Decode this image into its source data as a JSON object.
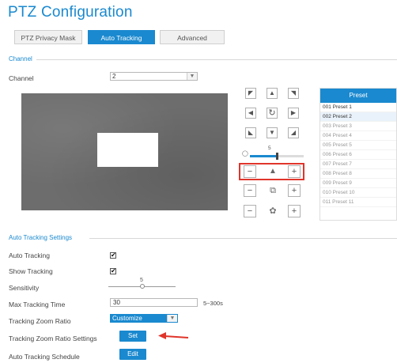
{
  "page": {
    "title": "PTZ Configuration"
  },
  "tabs": [
    {
      "label": "PTZ Privacy Mask"
    },
    {
      "label": "Auto Tracking"
    },
    {
      "label": "Advanced"
    }
  ],
  "channel_section": {
    "heading": "Channel",
    "channel_label": "Channel",
    "channel_value": "2"
  },
  "ptz": {
    "speed_value": "5",
    "speed_level": 0.5
  },
  "presets": {
    "header": "Preset",
    "items": [
      "001 Preset 1",
      "002 Preset 2",
      "003 Preset 3",
      "004 Preset 4",
      "005 Preset 5",
      "006 Preset 6",
      "007 Preset 7",
      "008 Preset 8",
      "009 Preset 9",
      "010 Preset 10",
      "011 Preset 11"
    ],
    "selected_index": 1
  },
  "settings": {
    "heading": "Auto Tracking Settings",
    "auto_tracking_label": "Auto Tracking",
    "auto_tracking_checked": true,
    "show_tracking_label": "Show Tracking",
    "show_tracking_checked": true,
    "sensitivity_label": "Sensitivity",
    "sensitivity_value": "5",
    "sensitivity_level": 0.5,
    "max_tracking_time_label": "Max Tracking Time",
    "max_tracking_time_value": "30",
    "max_tracking_time_range": "5~300s",
    "zoom_ratio_label": "Tracking Zoom Ratio",
    "zoom_ratio_value": "Customize",
    "zoom_ratio_settings_label": "Tracking Zoom Ratio Settings",
    "set_button": "Set",
    "schedule_label": "Auto Tracking Schedule",
    "edit_button": "Edit"
  },
  "colors": {
    "accent": "#1a89cf",
    "highlight_box": "#e0352b",
    "arrow": "#e0352b"
  }
}
